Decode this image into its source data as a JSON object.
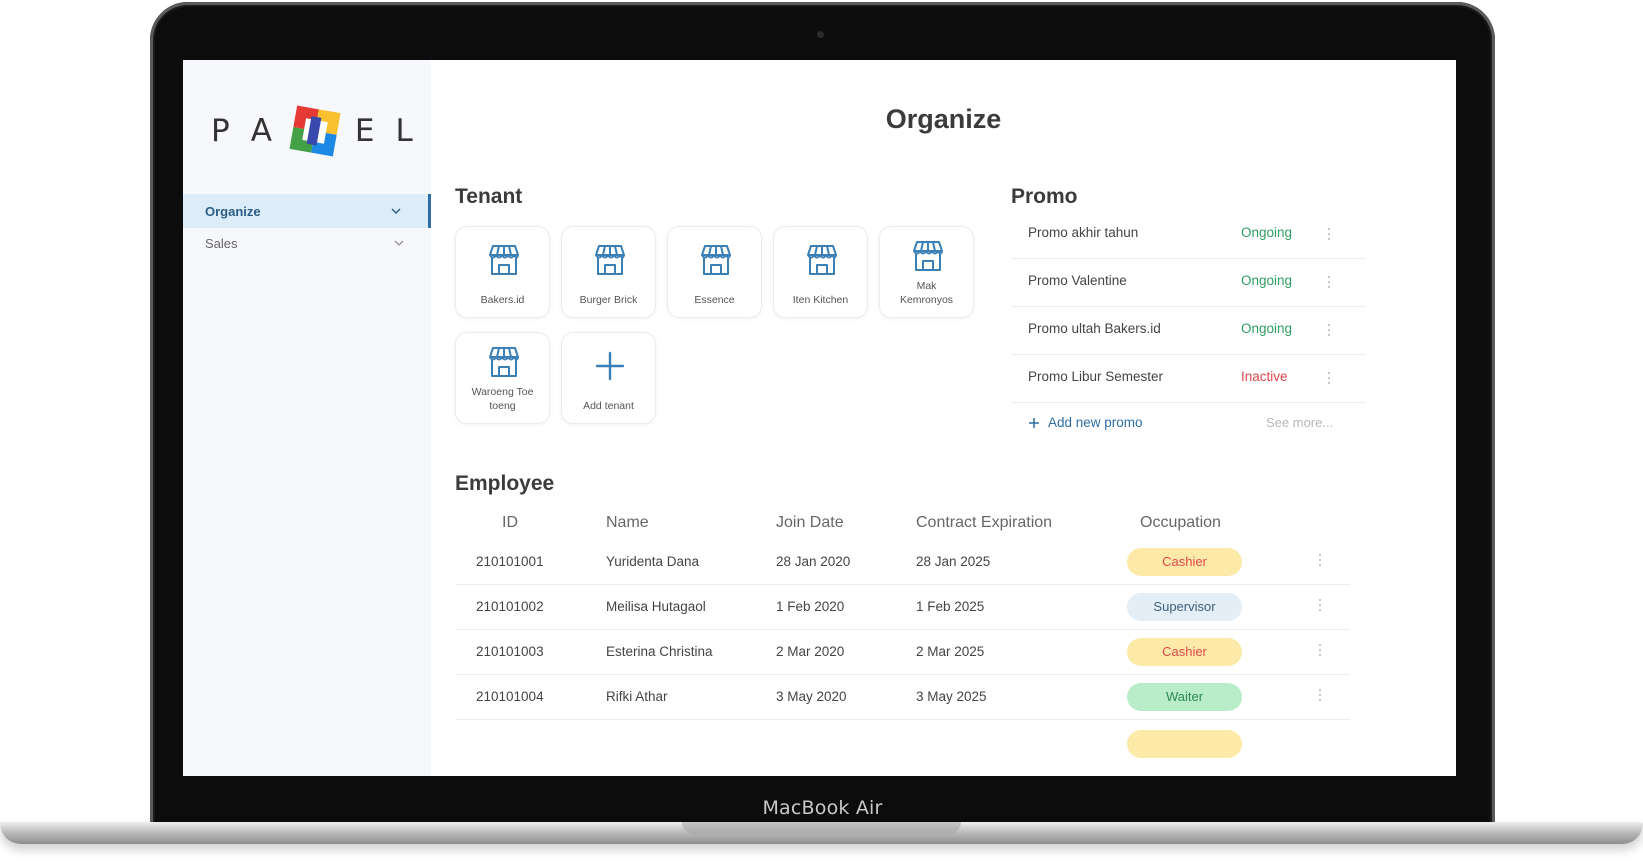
{
  "device": {
    "label": "MacBook Air"
  },
  "app": {
    "logo": {
      "letters_left": [
        "P",
        "A"
      ],
      "letters_right": [
        "E",
        "L"
      ]
    },
    "page_title": "Organize"
  },
  "sidebar": {
    "items": [
      {
        "label": "Organize",
        "active": true
      },
      {
        "label": "Sales",
        "active": false
      }
    ]
  },
  "tenant": {
    "title": "Tenant",
    "items": [
      {
        "name": "Bakers.id",
        "icon": "store-icon"
      },
      {
        "name": "Burger Brick",
        "icon": "store-icon"
      },
      {
        "name": "Essence",
        "icon": "store-icon"
      },
      {
        "name": "Iten Kitchen",
        "icon": "store-icon"
      },
      {
        "name": "Mak\nKemronyos",
        "icon": "store-icon"
      },
      {
        "name": "Waroeng Toe\ntoeng",
        "icon": "store-icon"
      }
    ],
    "add_label": "Add tenant"
  },
  "promo": {
    "title": "Promo",
    "items": [
      {
        "name": "Promo akhir tahun",
        "status": "Ongoing"
      },
      {
        "name": "Promo Valentine",
        "status": "Ongoing"
      },
      {
        "name": "Promo ultah Bakers.id",
        "status": "Ongoing"
      },
      {
        "name": "Promo Libur Semester",
        "status": "Inactive"
      }
    ],
    "add_label": "Add new promo",
    "see_more_label": "See more..."
  },
  "employee": {
    "title": "Employee",
    "columns": [
      "ID",
      "Name",
      "Join Date",
      "Contract Expiration",
      "Occupation"
    ],
    "rows": [
      {
        "id": "210101001",
        "name": "Yuridenta Dana",
        "join": "28 Jan 2020",
        "expiration": "28 Jan 2025",
        "occupation": "Cashier"
      },
      {
        "id": "210101002",
        "name": "Meilisa Hutagaol",
        "join": "1 Feb 2020",
        "expiration": "1 Feb 2025",
        "occupation": "Supervisor"
      },
      {
        "id": "210101003",
        "name": "Esterina Christina",
        "join": "2 Mar 2020",
        "expiration": "2 Mar 2025",
        "occupation": "Cashier"
      },
      {
        "id": "210101004",
        "name": "Rifki Athar",
        "join": "3 May 2020",
        "expiration": "3 May 2025",
        "occupation": "Waiter"
      }
    ]
  },
  "colors": {
    "accent": "#2f6ea5",
    "icon_blue": "#3a7fb5",
    "ongoing": "#2e9e62",
    "inactive": "#e0474c",
    "cashier_bg": "#fde9a8",
    "cashier_text": "#e0474c",
    "supervisor_bg": "#e3eef6",
    "supervisor_text": "#3b5f7d",
    "waiter_bg": "#b9ecc8",
    "waiter_text": "#2e8a55"
  }
}
